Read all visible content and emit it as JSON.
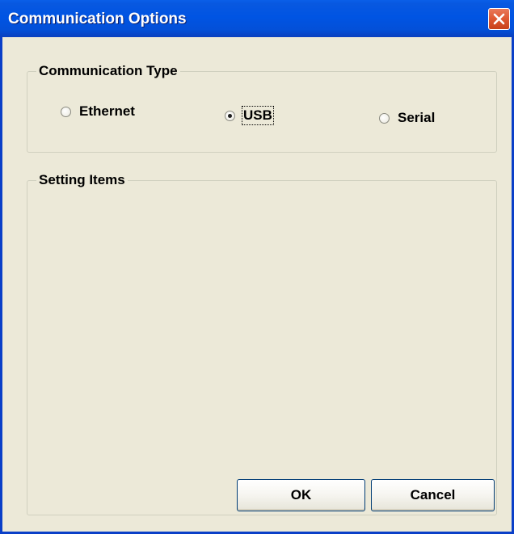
{
  "window": {
    "title": "Communication Options",
    "close_icon": "close-icon",
    "colors": {
      "titlebar": "#0054e3",
      "body": "#ece9d8",
      "close_button": "#e05a35"
    }
  },
  "communication_type": {
    "legend": "Communication Type",
    "options": [
      {
        "label": "Ethernet",
        "checked": false
      },
      {
        "label": "USB",
        "checked": true
      },
      {
        "label": "Serial",
        "checked": false
      }
    ]
  },
  "setting_items": {
    "legend": "Setting Items"
  },
  "buttons": {
    "ok": "OK",
    "cancel": "Cancel"
  }
}
